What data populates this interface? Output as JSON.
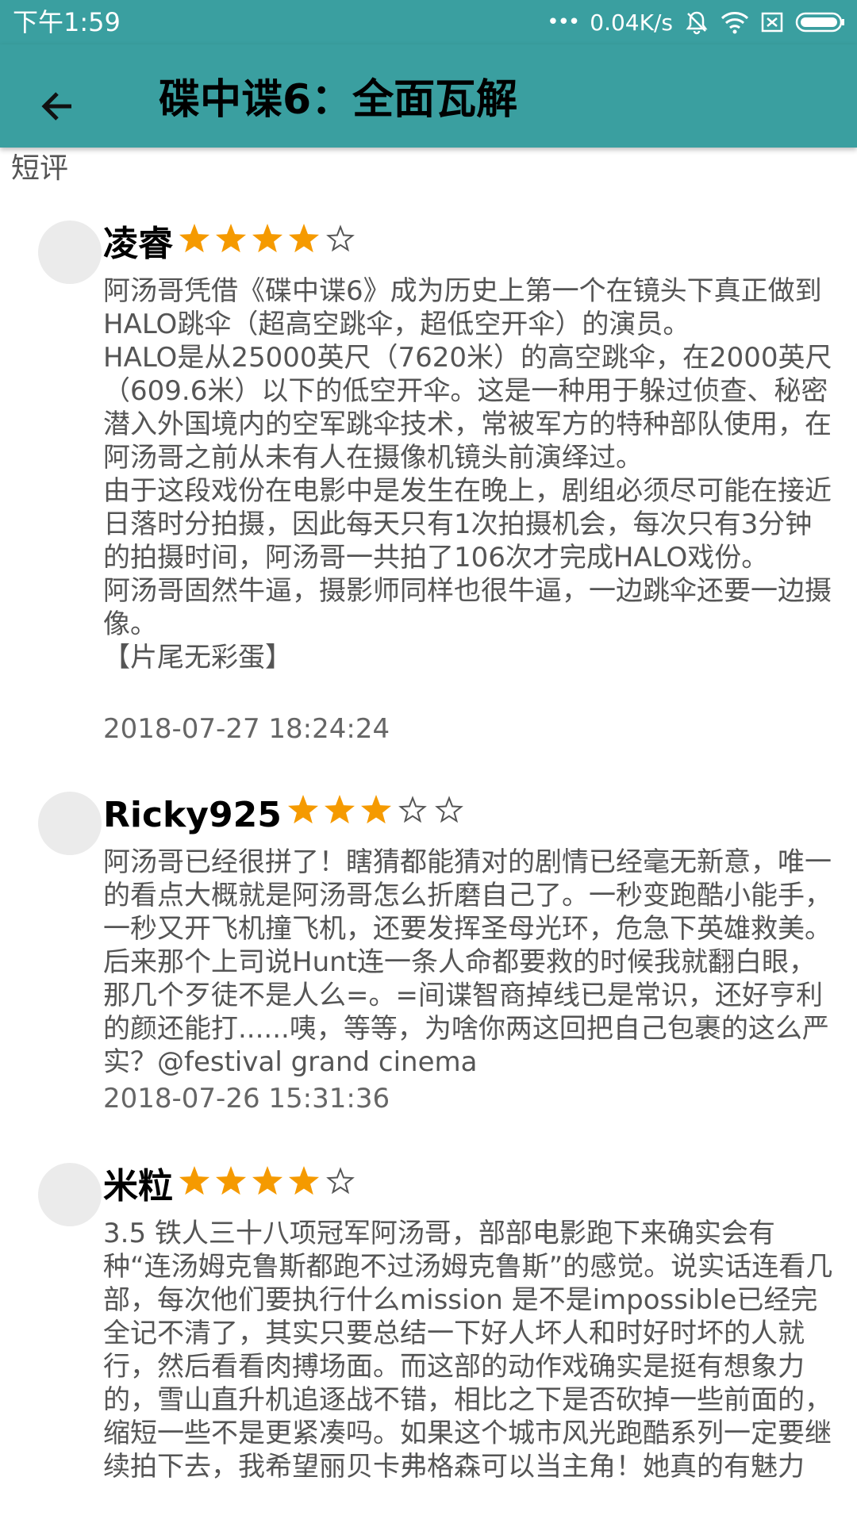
{
  "status_bar": {
    "time": "下午1:59",
    "more": "•••",
    "network_speed": "0.04K/s",
    "icons": [
      "mute-icon",
      "wifi-icon",
      "sim-icon",
      "battery-icon"
    ]
  },
  "app_bar": {
    "back_icon": "arrow-left-icon",
    "title": "碟中谍6：全面瓦解"
  },
  "section_label": "短评",
  "colors": {
    "primary": "#3a9fa0",
    "star_filled": "#f59a00",
    "star_empty": "#555555"
  },
  "reviews": [
    {
      "name": "凌睿",
      "rating": 4,
      "max_rating": 5,
      "text": "阿汤哥凭借《碟中谍6》成为历史上第一个在镜头下真正做到HALO跳伞（超高空跳伞，超低空开伞）的演员。\nHALO是从25000英尺（7620米）的高空跳伞，在2000英尺（609.6米）以下的低空开伞。这是一种用于躲过侦查、秘密潜入外国境内的空军跳伞技术，常被军方的特种部队使用，在阿汤哥之前从未有人在摄像机镜头前演绎过。\n由于这段戏份在电影中是发生在晚上，剧组必须尽可能在接近日落时分拍摄，因此每天只有1次拍摄机会，每次只有3分钟的拍摄时间，阿汤哥一共拍了106次才完成HALO戏份。\n阿汤哥固然牛逼，摄影师同样也很牛逼，一边跳伞还要一边摄像。\n【片尾无彩蛋】",
      "date": "2018-07-27 18:24:24"
    },
    {
      "name": "Ricky925",
      "rating": 3,
      "max_rating": 5,
      "text": "阿汤哥已经很拼了！瞎猜都能猜对的剧情已经毫无新意，唯一的看点大概就是阿汤哥怎么折磨自己了。一秒变跑酷小能手，一秒又开飞机撞飞机，还要发挥圣母光环，危急下英雄救美。后来那个上司说Hunt连一条人命都要救的时候我就翻白眼，那几个歹徒不是人么=。=间谍智商掉线已是常识，还好亨利的颜还能打......咦，等等，为啥你两这回把自己包裹的这么严实？@festival grand cinema",
      "date": "2018-07-26 15:31:36"
    },
    {
      "name": "米粒",
      "rating": 4,
      "max_rating": 5,
      "text": "3.5 铁人三十八项冠军阿汤哥，部部电影跑下来确实会有种“连汤姆克鲁斯都跑不过汤姆克鲁斯”的感觉。说实话连看几部，每次他们要执行什么mission 是不是impossible已经完全记不清了，其实只要总结一下好人坏人和时好时坏的人就行，然后看看肉搏场面。而这部的动作戏确实是挺有想象力的，雪山直升机追逐战不错，相比之下是否砍掉一些前面的，缩短一些不是更紧凑吗。如果这个城市风光跑酷系列一定要继续拍下去，我希望丽贝卡弗格森可以当主角！她真的有魅力",
      "date": ""
    }
  ]
}
